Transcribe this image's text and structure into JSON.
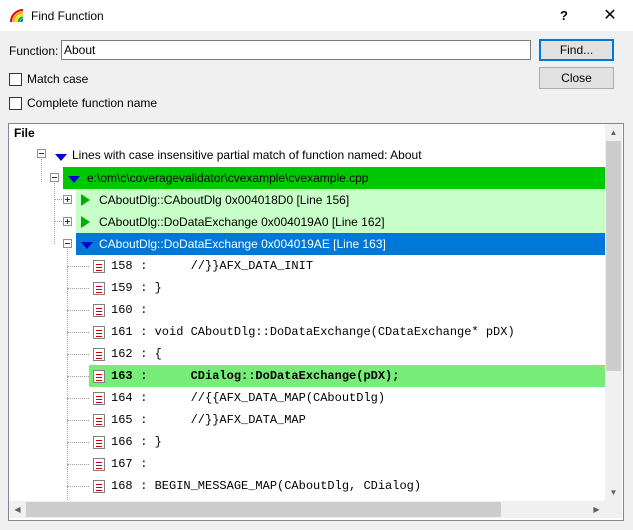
{
  "window": {
    "title": "Find Function",
    "help_glyph": "?",
    "close_glyph": "✕"
  },
  "form": {
    "function_label": "Function:",
    "function_value": "About",
    "find_button": "Find...",
    "close_button": "Close",
    "match_case_label": "Match case",
    "match_case_checked": false,
    "complete_name_label": "Complete function name",
    "complete_name_checked": false
  },
  "tree": {
    "header": "File",
    "root": "Lines with case insensitive partial match of function named: About",
    "file": "e:\\om\\c\\coveragevalidator\\cvexample\\cvexample.cpp",
    "functions": [
      {
        "label": "CAboutDlg::CAboutDlg 0x004018D0 [Line 156]"
      },
      {
        "label": "CAboutDlg::DoDataExchange 0x004019A0 [Line 162]"
      },
      {
        "label": "CAboutDlg::DoDataExchange 0x004019AE [Line 163]"
      }
    ],
    "lines": [
      {
        "num": "158",
        "code": " :      //}}AFX_DATA_INIT"
      },
      {
        "num": "159",
        "code": " : }"
      },
      {
        "num": "160",
        "code": " :"
      },
      {
        "num": "161",
        "code": " : void CAboutDlg::DoDataExchange(CDataExchange* pDX)"
      },
      {
        "num": "162",
        "code": " : {"
      },
      {
        "num": "163",
        "code": " :      CDialog::DoDataExchange(pDX);"
      },
      {
        "num": "164",
        "code": " :      //{{AFX_DATA_MAP(CAboutDlg)"
      },
      {
        "num": "165",
        "code": " :      //}}AFX_DATA_MAP"
      },
      {
        "num": "166",
        "code": " : }"
      },
      {
        "num": "167",
        "code": " :"
      },
      {
        "num": "168",
        "code": " : BEGIN_MESSAGE_MAP(CAboutDlg, CDialog)"
      }
    ]
  },
  "colors": {
    "file_row": "#00c800",
    "function_row": "#c8ffc8",
    "selected_row": "#0078d7",
    "highlight_line": "#78ec78"
  }
}
